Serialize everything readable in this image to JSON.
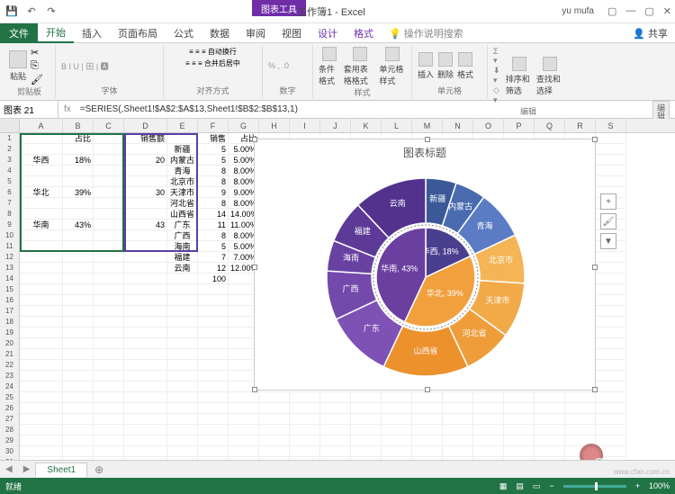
{
  "titlebar": {
    "qat_save": "💾",
    "ctx_tab": "图表工具",
    "doc_title": "工作簿1 - Excel",
    "user": "yu mufa"
  },
  "tabs": {
    "file": "文件",
    "home": "开始",
    "insert": "插入",
    "layout": "页面布局",
    "formulas": "公式",
    "data": "数据",
    "review": "审阅",
    "view": "视图",
    "design": "设计",
    "format": "格式",
    "tell": "操作说明搜索",
    "share": "共享"
  },
  "ribbon": {
    "clipboard": "剪贴板",
    "paste": "粘贴",
    "font": "字体",
    "align": "对齐方式",
    "wrap": "自动换行",
    "merge": "合并后居中",
    "number": "数字",
    "cond": "条件格式",
    "table": "套用表格格式",
    "cellstyle": "单元格样式",
    "styles": "样式",
    "insert_c": "插入",
    "delete_c": "删除",
    "format_c": "格式",
    "cells": "单元格",
    "sort": "排序和筛选",
    "find": "查找和选择",
    "editing": "编辑"
  },
  "formula_bar": {
    "name": "图表 21",
    "formula": "=SERIES(,Sheet1!$A$2:$A$13,Sheet1!$B$2:$B$13,1)"
  },
  "cols": [
    "A",
    "B",
    "C",
    "D",
    "E",
    "F",
    "G",
    "H",
    "I",
    "J",
    "K",
    "L",
    "M",
    "N",
    "O",
    "P",
    "Q",
    "R",
    "S"
  ],
  "table1": {
    "h1": "占比",
    "h2": "销售额",
    "r1": {
      "name": "华西",
      "pct": "18%",
      "sales": "20"
    },
    "r2": {
      "name": "华北",
      "pct": "39%",
      "sales": "30"
    },
    "r3": {
      "name": "华南",
      "pct": "43%",
      "sales": "43"
    }
  },
  "table2": {
    "h1": "销售",
    "h2": "占比",
    "rows": [
      {
        "name": "新疆",
        "v": "5",
        "p": "5.00%"
      },
      {
        "name": "内蒙古",
        "v": "5",
        "p": "5.00%"
      },
      {
        "name": "青海",
        "v": "8",
        "p": "8.00%"
      },
      {
        "name": "北京市",
        "v": "8",
        "p": "8.00%"
      },
      {
        "name": "天津市",
        "v": "9",
        "p": "9.00%"
      },
      {
        "name": "河北省",
        "v": "8",
        "p": "8.00%"
      },
      {
        "name": "山西省",
        "v": "14",
        "p": "14.00%"
      },
      {
        "name": "广东",
        "v": "11",
        "p": "11.00%"
      },
      {
        "name": "广西",
        "v": "8",
        "p": "8.00%"
      },
      {
        "name": "海南",
        "v": "5",
        "p": "5.00%"
      },
      {
        "name": "福建",
        "v": "7",
        "p": "7.00%"
      },
      {
        "name": "云南",
        "v": "12",
        "p": "12.00%"
      }
    ],
    "total": "100"
  },
  "chart": {
    "title": "图表标题"
  },
  "chart_data": {
    "type": "pie",
    "title": "图表标题",
    "inner": {
      "series": [
        {
          "name": "华西",
          "value": 18,
          "color": "#4a3f8f"
        },
        {
          "name": "华北",
          "value": 39,
          "color": "#f2a03d"
        },
        {
          "name": "华南",
          "value": 43,
          "color": "#6b3fa0"
        }
      ]
    },
    "outer": {
      "series": [
        {
          "name": "新疆",
          "value": 5,
          "group": "华西",
          "color": "#3b5998"
        },
        {
          "name": "内蒙古",
          "value": 5,
          "group": "华西",
          "color": "#4a6bb0"
        },
        {
          "name": "青海",
          "value": 8,
          "group": "华西",
          "color": "#5b7cc4"
        },
        {
          "name": "北京市",
          "value": 8,
          "group": "华北",
          "color": "#f5b556"
        },
        {
          "name": "天津市",
          "value": 9,
          "group": "华北",
          "color": "#f2a948"
        },
        {
          "name": "河北省",
          "value": 8,
          "group": "华北",
          "color": "#ef9d3a"
        },
        {
          "name": "山西省",
          "value": 14,
          "group": "华北",
          "color": "#ec912c"
        },
        {
          "name": "广东",
          "value": 11,
          "group": "华南",
          "color": "#7e52b5"
        },
        {
          "name": "广西",
          "value": 8,
          "group": "华南",
          "color": "#734aab"
        },
        {
          "name": "海南",
          "value": 5,
          "group": "华南",
          "color": "#6842a1"
        },
        {
          "name": "福建",
          "value": 7,
          "group": "华南",
          "color": "#5d3a97"
        },
        {
          "name": "云南",
          "value": 12,
          "group": "华南",
          "color": "#52328d"
        }
      ]
    }
  },
  "sheet_tab": "Sheet1",
  "status": {
    "ready": "就绪",
    "zoom": "100%"
  },
  "editbar": "编辑栏",
  "watermark": "www.cfan.com.cn"
}
